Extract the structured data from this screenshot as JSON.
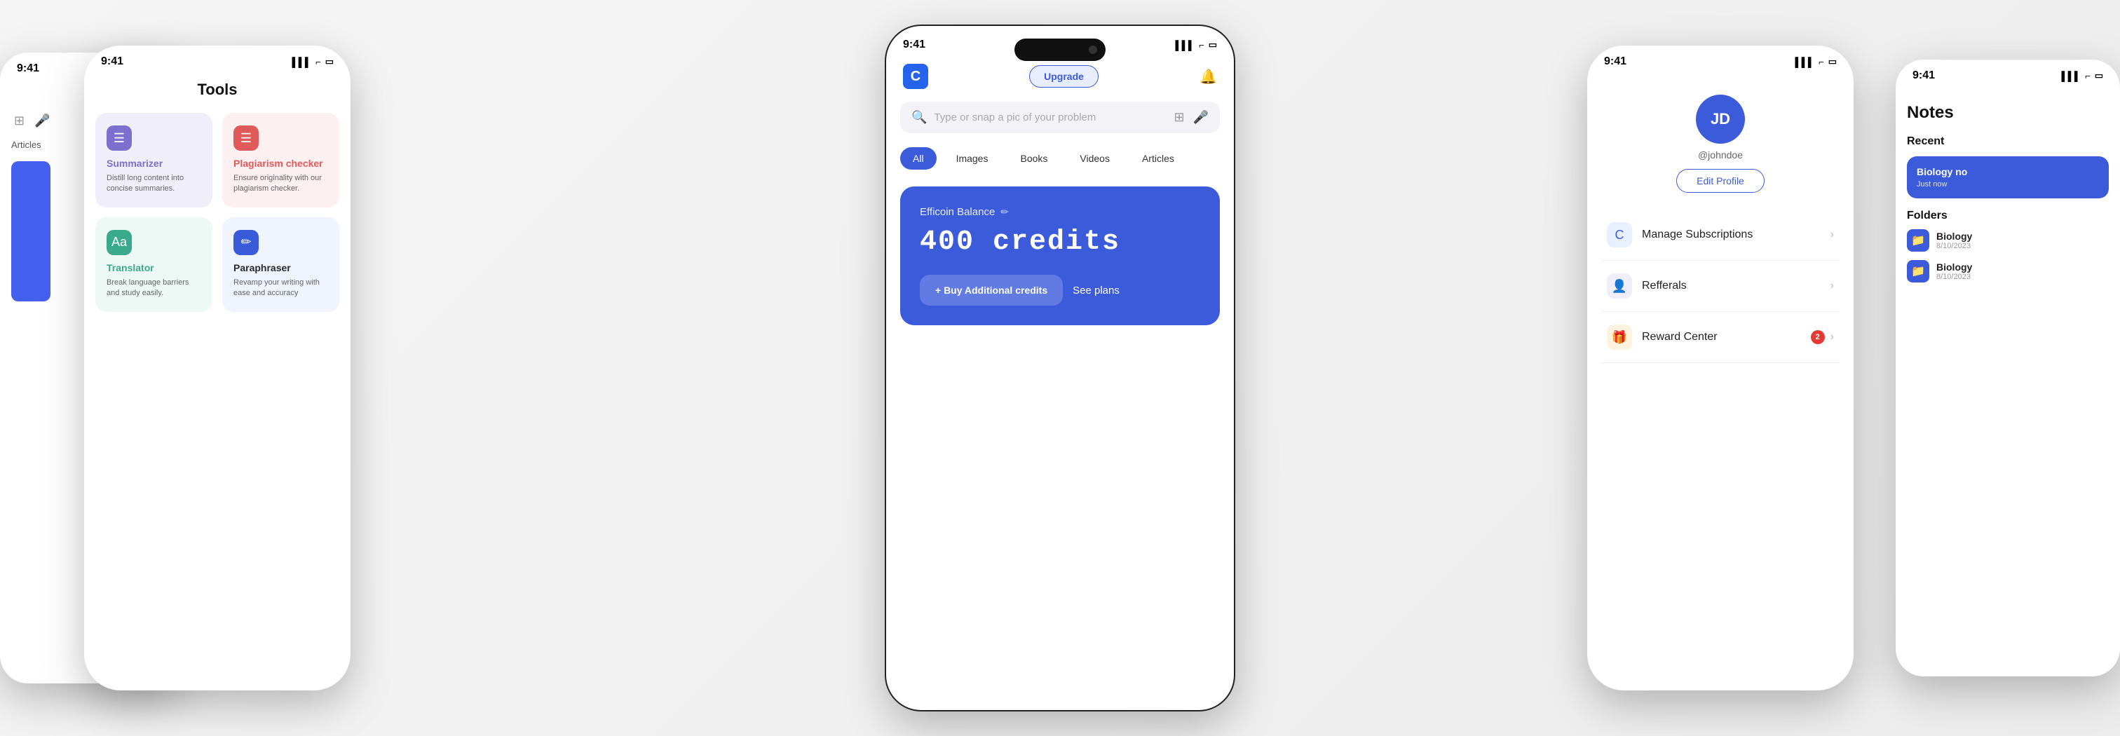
{
  "background": "#f0f0f0",
  "phone1": {
    "status_time": "9:41",
    "articles_label": "Articles"
  },
  "phone2": {
    "status_time": "9:41",
    "title": "Tools",
    "tools": [
      {
        "name": "Summarizer",
        "name_color": "purple-text",
        "desc": "Distill long content into concise summaries.",
        "icon_color": "purple",
        "bg": "purple-light",
        "icon": "☰"
      },
      {
        "name": "Plagiarism checker",
        "name_color": "pink-text",
        "desc": "Ensure originality with our plagiarism checker.",
        "icon_color": "pink",
        "bg": "pink-light",
        "icon": "☰"
      },
      {
        "name": "Translator",
        "name_color": "teal-text",
        "desc": "Break language barriers and study easily.",
        "icon_color": "teal",
        "bg": "teal-light",
        "icon": "Aa"
      },
      {
        "name": "Paraphraser",
        "name_color": "dark-text",
        "desc": "Revamp your writing with ease and accuracy",
        "icon_color": "dark-blue",
        "bg": "light-blue",
        "icon": "✏"
      }
    ]
  },
  "phone3": {
    "status_time": "9:41",
    "upgrade_label": "Upgrade",
    "search_placeholder": "Type or snap a pic of your problem",
    "filter_tabs": [
      "All",
      "Images",
      "Books",
      "Videos",
      "Articles"
    ],
    "active_tab": "All",
    "credits_card": {
      "label": "Efficoin Balance",
      "amount": "400 credits",
      "buy_btn": "+ Buy Additional credits",
      "see_plans": "See plans"
    }
  },
  "phone4": {
    "status_time": "9:41",
    "avatar_initials": "JD",
    "username": "@johndoe",
    "edit_profile_label": "Edit Profile",
    "menu_items": [
      {
        "label": "Manage Subscriptions",
        "icon": "C",
        "icon_bg": "blue-bg",
        "badge": null
      },
      {
        "label": "Refferals",
        "icon": "👤",
        "icon_bg": "purple-bg",
        "badge": null
      },
      {
        "label": "Reward Center",
        "icon": "🎁",
        "icon_bg": "orange-bg",
        "badge": "2"
      }
    ]
  },
  "phone5": {
    "status_time": "9:41",
    "title": "Notes",
    "recent_label": "Recent",
    "note": {
      "title": "Biology no",
      "time": "Just now"
    },
    "folders_label": "Folders",
    "folders": [
      {
        "name": "Biology",
        "date": "8/10/2023"
      },
      {
        "name": "Biology",
        "date": "8/10/2023"
      }
    ]
  }
}
